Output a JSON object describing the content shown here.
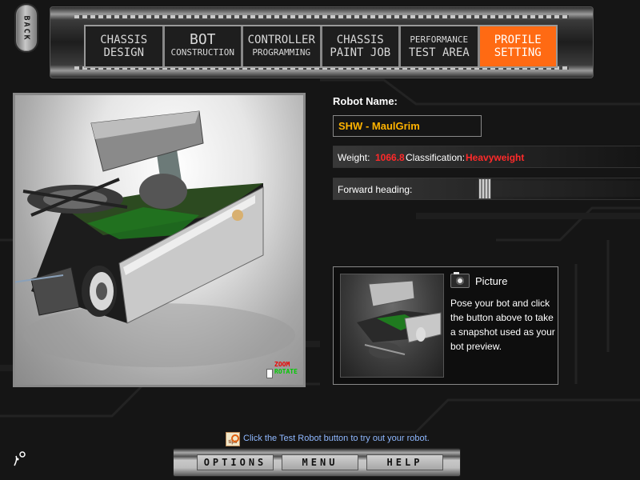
{
  "nav": {
    "back_label": "BACK",
    "tabs": [
      {
        "line1": "CHASSIS",
        "line2": "DESIGN",
        "active": false
      },
      {
        "line1": "BOT",
        "line2": "CONSTRUCTION",
        "active": false
      },
      {
        "line1": "CONTROLLER",
        "line2": "PROGRAMMING",
        "active": false
      },
      {
        "line1": "CHASSIS",
        "line2": "PAINT JOB",
        "active": false
      },
      {
        "line1": "PERFORMANCE",
        "line2": "TEST AREA",
        "active": false
      },
      {
        "line1": "PROFILE",
        "line2": "SETTING",
        "active": true
      }
    ]
  },
  "preview": {
    "zoom_label": "ZOOM",
    "rotate_label": "ROTATE"
  },
  "profile": {
    "robot_name_label": "Robot Name:",
    "robot_name_value": "SHW - MaulGrim",
    "weight_label": "Weight:",
    "weight_value": "1066.8",
    "classification_label": "Classification:",
    "classification_value": "Heavyweight",
    "forward_heading_label": "Forward heading:",
    "forward_heading_level": 0.02
  },
  "picture": {
    "title": "Picture",
    "description": "Pose your bot and click the button above to take a snapshot used as your bot preview."
  },
  "tips": {
    "icon_label": "tips",
    "text": "Click the Test Robot button to try out your robot."
  },
  "bottom": {
    "options_label": "OPTIONS",
    "menu_label": "MENU",
    "help_label": "HELP"
  },
  "colors": {
    "active_tab": "#ff6a13",
    "robot_name": "#ffb300",
    "stat_value": "#ff2a2a",
    "tips_text": "#8fb8ff"
  }
}
